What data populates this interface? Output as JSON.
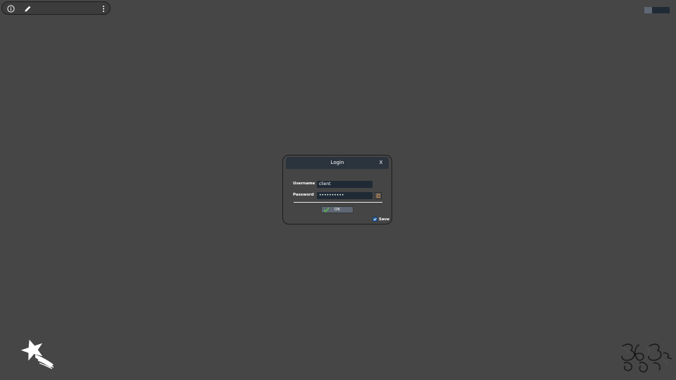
{
  "toolbar": {
    "icons": [
      "info-icon",
      "pencil-icon",
      "more-vertical-icon"
    ]
  },
  "dialog": {
    "title": "Login",
    "close_label": "X",
    "username_label": "Username",
    "username_value": "client",
    "password_label": "Password",
    "password_value": "••••••••••",
    "ok_label": "OK",
    "save_label": "Save",
    "save_checked": true
  },
  "colors": {
    "background": "#464646",
    "dialog_header": "#2b333d",
    "input_bg": "#1f2a35",
    "ok_button": "#5e6773",
    "checkbox": "#2b6cb0"
  }
}
